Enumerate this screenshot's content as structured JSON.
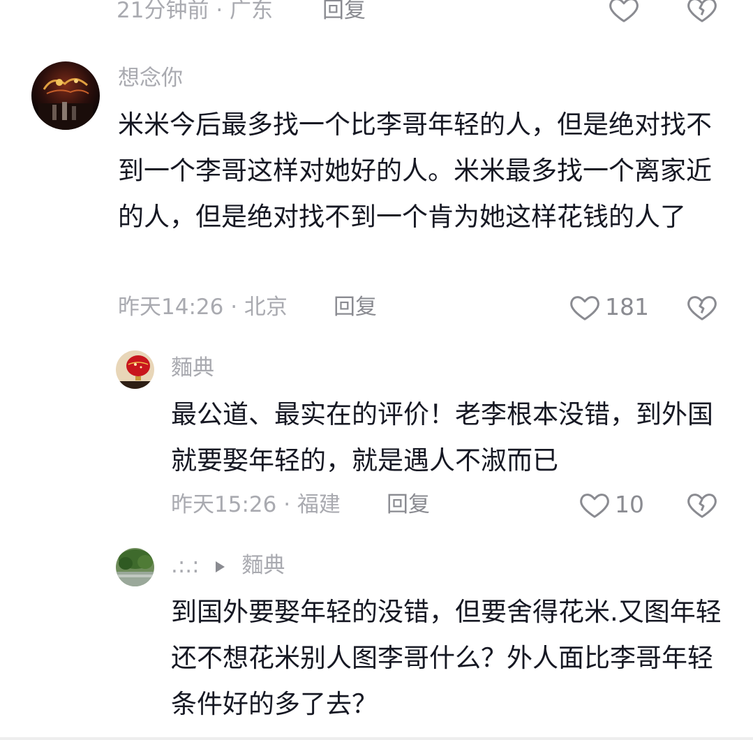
{
  "top": {
    "time": "21分钟前",
    "location": "广东",
    "reply_label": "回复"
  },
  "comments": [
    {
      "username": "想念你",
      "text": "米米今后最多找一个比李哥年轻的人，但是绝对找不到一个李哥这样对她好的人。米米最多找一个离家近的人，但是绝对找不到一个肯为她这样花钱的人了",
      "time": "昨天14:26",
      "location": "北京",
      "reply_label": "回复",
      "likes": "181"
    },
    {
      "username": "麵典",
      "text": "最公道、最实在的评价！老李根本没错，到外国就要娶年轻的，就是遇人不淑而已",
      "time": "昨天15:26",
      "location": "福建",
      "reply_label": "回复",
      "likes": "10"
    },
    {
      "username": ".:.:",
      "reply_to": "麵典",
      "text": "到国外要娶年轻的没错，但要舍得花米.又图年轻还不想花米别人图李哥什么？外人面比李哥年轻条件好的多了去？"
    }
  ],
  "colors": {
    "text": "#161823",
    "meta": "#a9aab0",
    "icon": "#8a8b91"
  }
}
